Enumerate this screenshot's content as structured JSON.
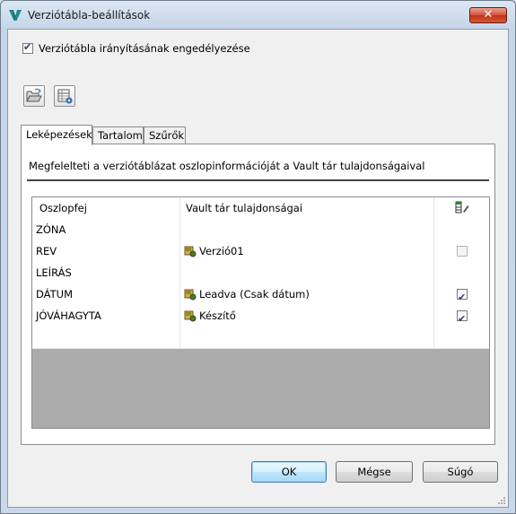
{
  "window": {
    "title": "Verziótábla-beállítások",
    "close_label": "✕"
  },
  "enable_checkbox": {
    "label": "Verziótábla irányításának engedélyezése",
    "checked": true
  },
  "toolbar": {
    "buttons": [
      {
        "icon": "open-folder-icon"
      },
      {
        "icon": "table-settings-icon"
      }
    ]
  },
  "tabs": [
    {
      "label": "Leképezések",
      "active": true
    },
    {
      "label": "Tartalom",
      "active": false
    },
    {
      "label": "Szűrők",
      "active": false
    }
  ],
  "panel": {
    "description": "Megfelelteti a verziótáblázat oszlopinformációját a Vault tár tulajdonságaival"
  },
  "grid": {
    "columns": {
      "col1": "Oszlopfej",
      "col2": "Vault tár tulajdonságai",
      "col3_icon": "edit-column-icon"
    },
    "rows": [
      {
        "column": "ZÓNA",
        "property": "",
        "checkbox": "none"
      },
      {
        "column": "REV",
        "property": "Verzió01",
        "checkbox": "disabled"
      },
      {
        "column": "LEÍRÁS",
        "property": "",
        "checkbox": "none"
      },
      {
        "column": "DÁTUM",
        "property": "Leadva (Csak dátum)",
        "checkbox": "checked"
      },
      {
        "column": "JÓVÁHAGYTA",
        "property": "Készítő",
        "checkbox": "checked"
      },
      {
        "column": "",
        "property": "",
        "checkbox": "none"
      }
    ]
  },
  "buttons": {
    "ok": "OK",
    "cancel": "Mégse",
    "help": "Súgó"
  }
}
